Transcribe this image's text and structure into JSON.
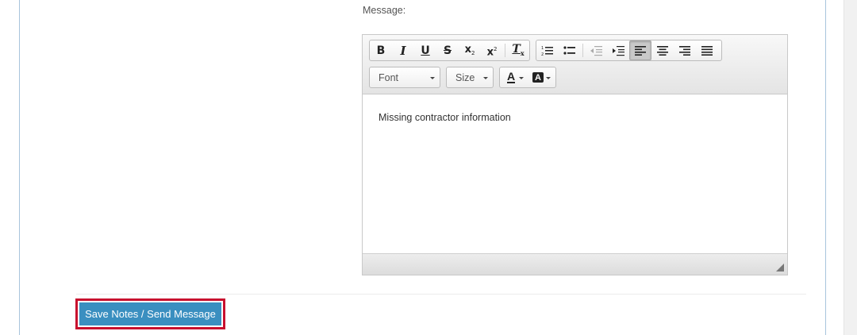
{
  "message_label": "Message:",
  "toolbar": {
    "bold": "B",
    "italic": "I",
    "underline": "U",
    "strike": "S",
    "subscript": "x",
    "subscript_mark": "2",
    "superscript": "x",
    "superscript_mark": "2",
    "remove_format": "T",
    "remove_format_mark": "x",
    "font_label": "Font",
    "size_label": "Size",
    "text_color_glyph": "A",
    "bg_color_glyph": "A"
  },
  "editor": {
    "content": "Missing contractor information"
  },
  "actions": {
    "save_label": "Save Notes / Send Message",
    "highlight_color": "#c8102e",
    "button_color": "#3a8fc0"
  }
}
